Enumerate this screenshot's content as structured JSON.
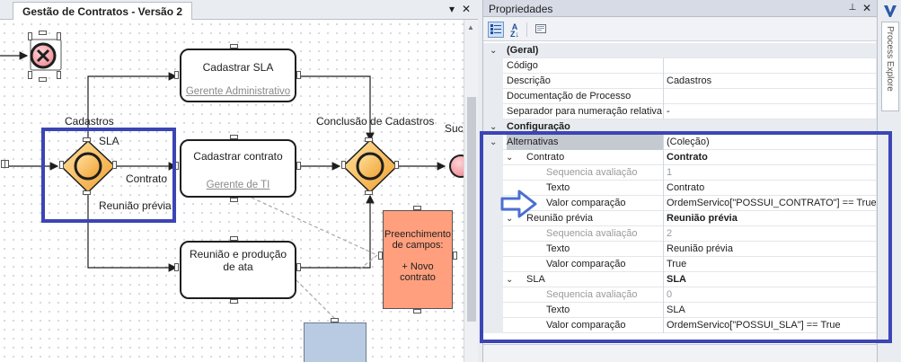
{
  "diagram": {
    "tab_title": "Gestão de Contratos - Versão 2",
    "pin_glyph": "▾",
    "close_glyph": "✕",
    "gateway_label_left": "Cadastros",
    "gateway_label_right": "Conclusão de Cadastros",
    "gateway_label_success": "Suce",
    "flow_label_sla": "SLA",
    "flow_label_contrato": "Contrato",
    "flow_label_reuniao": "Reunião prévia",
    "tasks": [
      {
        "title": "Cadastrar SLA",
        "role": "Gerente Administrativo"
      },
      {
        "title": "Cadastrar contrato",
        "role": "Gerente de TI"
      },
      {
        "title": "Reunião e produção de ata",
        "role": ""
      }
    ],
    "note_text": "Preenchimento de campos:\n\n+ Novo contrato"
  },
  "properties": {
    "title": "Propriedades",
    "pin_glyph": "📌",
    "close_glyph": "✕",
    "toolbar": {
      "categorized_icon": "categorized-icon",
      "sort_icon": "alphabetical-sort-icon",
      "pages_icon": "property-pages-icon"
    },
    "rows": [
      {
        "kind": "cat",
        "toggle": "⌄",
        "name": "(Geral)",
        "value": ""
      },
      {
        "kind": "prop",
        "name": "Código",
        "value": "",
        "indent": 0
      },
      {
        "kind": "prop",
        "name": "Descrição",
        "value": "Cadastros",
        "indent": 0
      },
      {
        "kind": "prop",
        "name": "Documentação de Processo",
        "value": "",
        "indent": 0
      },
      {
        "kind": "prop",
        "name": "Separador para numeração relativa",
        "value": "-",
        "indent": 0
      },
      {
        "kind": "cat",
        "toggle": "⌄",
        "name": "Configuração",
        "value": ""
      },
      {
        "kind": "sel",
        "toggle": "⌄",
        "name": "Alternativas",
        "value": "(Coleção)",
        "indent": 0
      },
      {
        "kind": "group",
        "toggle": "⌄",
        "name": "Contrato",
        "value": "Contrato",
        "indent": 1
      },
      {
        "kind": "prop",
        "name": "Sequencia avaliação",
        "value": "1",
        "indent": 2,
        "gray": true
      },
      {
        "kind": "prop",
        "name": "Texto",
        "value": "Contrato",
        "indent": 2
      },
      {
        "kind": "prop",
        "name": "Valor comparação",
        "value": "OrdemServico[\"POSSUI_CONTRATO\"] == True",
        "indent": 2
      },
      {
        "kind": "group",
        "toggle": "⌄",
        "name": "Reunião prévia",
        "value": "Reunião prévia",
        "indent": 1
      },
      {
        "kind": "prop",
        "name": "Sequencia avaliação",
        "value": "2",
        "indent": 2,
        "gray": true
      },
      {
        "kind": "prop",
        "name": "Texto",
        "value": "Reunião prévia",
        "indent": 2
      },
      {
        "kind": "prop",
        "name": "Valor comparação",
        "value": "True",
        "indent": 2
      },
      {
        "kind": "group",
        "toggle": "⌄",
        "name": "SLA",
        "value": "SLA",
        "indent": 1
      },
      {
        "kind": "prop",
        "name": "Sequencia avaliação",
        "value": "0",
        "indent": 2,
        "gray": true
      },
      {
        "kind": "prop",
        "name": "Texto",
        "value": "SLA",
        "indent": 2
      },
      {
        "kind": "prop",
        "name": "Valor comparação",
        "value": "OrdemServico[\"POSSUI_SLA\"] == True",
        "indent": 2
      }
    ]
  },
  "sidebar": {
    "tab_label": "Process Explore"
  },
  "colors": {
    "highlight": "#3b45b5",
    "gateway_fill": "#f6b94a",
    "note_fill": "#ff9f7e",
    "arrow": "#4a6fd1"
  }
}
